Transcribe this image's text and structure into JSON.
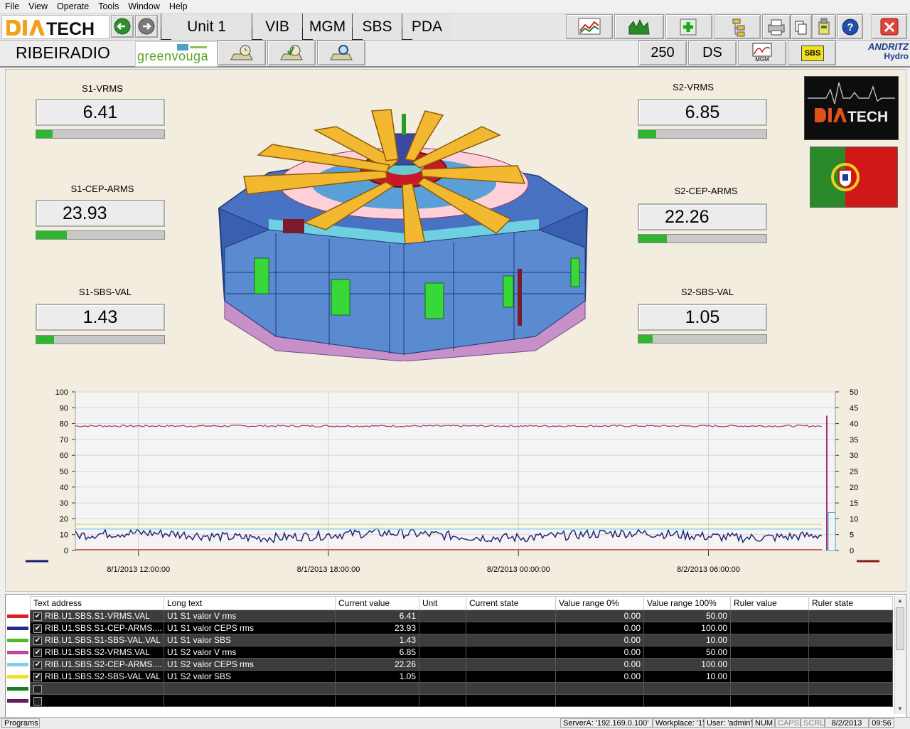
{
  "menu": [
    "File",
    "View",
    "Operate",
    "Tools",
    "Window",
    "Help"
  ],
  "toolbar": {
    "logo": "DIATECH",
    "unit_label": "Unit 1",
    "tabs": [
      "VIB",
      "MGM",
      "SBS",
      "PDA"
    ]
  },
  "toolbar2": {
    "plant_name": "RIBEIRADIO",
    "client_logo": "greenvouga",
    "speed_value": "250",
    "mode_value": "DS",
    "mgm_label": "MGM",
    "sbs_label": "SBS",
    "brand_logo_top": "ANDRITZ",
    "brand_logo_bottom": "Hydro"
  },
  "gauges": {
    "s1_vrms": {
      "label": "S1-VRMS",
      "value": "6.41",
      "fill": 0.13
    },
    "s1_cep": {
      "label": "S1-CEP-ARMS",
      "value": "23.93",
      "fill": 0.24
    },
    "s1_sbs": {
      "label": "S1-SBS-VAL",
      "value": "1.43",
      "fill": 0.14
    },
    "s2_vrms": {
      "label": "S2-VRMS",
      "value": "6.85",
      "fill": 0.14
    },
    "s2_cep": {
      "label": "S2-CEP-ARMS",
      "value": "22.26",
      "fill": 0.22
    },
    "s2_sbs": {
      "label": "S2-SBS-VAL",
      "value": "1.05",
      "fill": 0.11
    }
  },
  "side_logo": "DIATECH",
  "chart_data": {
    "type": "line",
    "left_axis": {
      "min": 0,
      "max": 100,
      "ticks": [
        0,
        10,
        20,
        30,
        40,
        50,
        60,
        70,
        80,
        90,
        100
      ]
    },
    "right_axis": {
      "min": 0,
      "max": 50,
      "ticks": [
        0,
        5,
        10,
        15,
        20,
        25,
        30,
        35,
        40,
        45,
        50
      ]
    },
    "x_tick_labels": [
      "8/1/2013 12:00:00",
      "8/1/2013 18:00:00",
      "8/2/2013 00:00:00",
      "8/2/2013 06:00:00"
    ],
    "grid": true,
    "series": [
      {
        "color": "#a0307a",
        "approx_level": 78.5
      },
      {
        "color": "#1c1c6e",
        "approx_level": 9.5
      },
      {
        "color": "#e8d850",
        "approx_level": 16.5
      },
      {
        "color": "#7ecfe6",
        "approx_level": 13.5
      },
      {
        "color": "#d02020",
        "approx_level": 0.5
      }
    ]
  },
  "table": {
    "headers": [
      "Text address",
      "Long text",
      "Current value",
      "Unit",
      "Current state",
      "Value range 0%",
      "Value range 100%",
      "Ruler value",
      "Ruler state"
    ],
    "rows": [
      {
        "color": "#d8202a",
        "checked": true,
        "address": "RIB.U1.SBS.S1-VRMS.VAL",
        "long": "U1 S1 valor V rms",
        "current": "6.41",
        "unit": "",
        "state": "",
        "r0": "0.00",
        "r100": "50.00",
        "ruler": "",
        "rstate": ""
      },
      {
        "color": "#2a2a8c",
        "checked": true,
        "address": "RIB.U1.SBS.S1-CEP-ARMS....",
        "long": "U1 S1 valor CEPS rms",
        "current": "23.93",
        "unit": "",
        "state": "",
        "r0": "0.00",
        "r100": "100.00",
        "ruler": "",
        "rstate": ""
      },
      {
        "color": "#54b82c",
        "checked": true,
        "address": "RIB.U1.SBS.S1-SBS-VAL.VAL",
        "long": "U1 S1 valor SBS",
        "current": "1.43",
        "unit": "",
        "state": "",
        "r0": "0.00",
        "r100": "10.00",
        "ruler": "",
        "rstate": ""
      },
      {
        "color": "#c0489a",
        "checked": true,
        "address": "RIB.U1.SBS.S2-VRMS.VAL",
        "long": "U1 S2 valor V rms",
        "current": "6.85",
        "unit": "",
        "state": "",
        "r0": "0.00",
        "r100": "50.00",
        "ruler": "",
        "rstate": ""
      },
      {
        "color": "#7ed0e8",
        "checked": true,
        "address": "RIB.U1.SBS.S2-CEP-ARMS....",
        "long": "U1 S2 valor CEPS rms",
        "current": "22.26",
        "unit": "",
        "state": "",
        "r0": "0.00",
        "r100": "100.00",
        "ruler": "",
        "rstate": ""
      },
      {
        "color": "#f0e020",
        "checked": true,
        "address": "RIB.U1.SBS.S2-SBS-VAL.VAL",
        "long": "U1 S2 valor SBS",
        "current": "1.05",
        "unit": "",
        "state": "",
        "r0": "0.00",
        "r100": "10.00",
        "ruler": "",
        "rstate": ""
      },
      {
        "color": "#1e7a1e",
        "checked": false,
        "address": "",
        "long": "",
        "current": "",
        "unit": "",
        "state": "",
        "r0": "",
        "r100": "",
        "ruler": "",
        "rstate": ""
      },
      {
        "color": "#6a1a6a",
        "checked": false,
        "address": "",
        "long": "",
        "current": "",
        "unit": "",
        "state": "",
        "r0": "",
        "r100": "",
        "ruler": "",
        "rstate": ""
      }
    ]
  },
  "status": {
    "programs": "Programs",
    "server": "ServerA: '192.169.0.100'",
    "workplace": "Workplace: '1'",
    "user": "User: 'admin'",
    "num": "NUM",
    "caps": "CAPS",
    "scrl": "SCRL",
    "date": "8/2/2013",
    "time": "09:56"
  }
}
